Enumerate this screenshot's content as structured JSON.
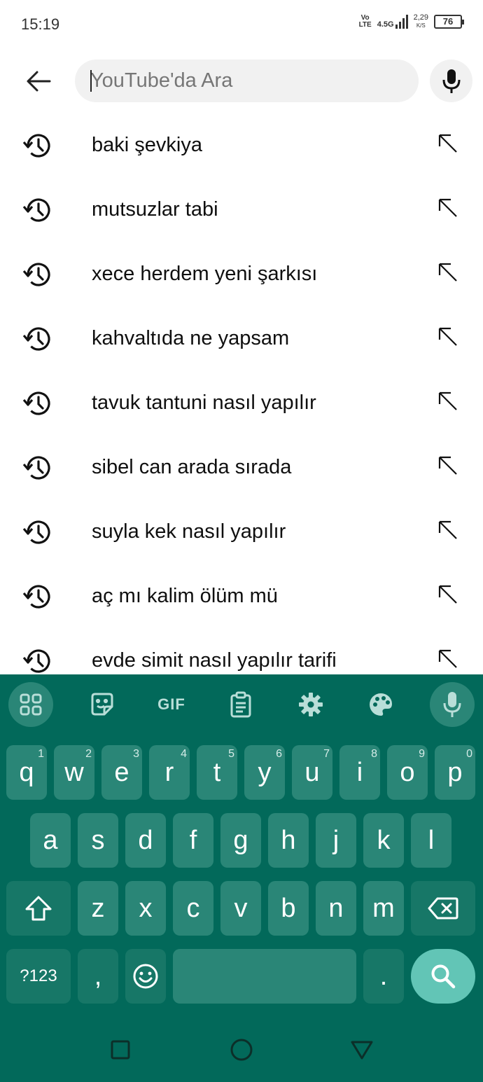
{
  "status_bar": {
    "time": "15:19",
    "volte_top": "Vo",
    "volte_bottom": "LTE",
    "network": "4.5G",
    "speed_value": "2,29",
    "speed_unit": "K/S",
    "battery": "76"
  },
  "search": {
    "placeholder": "YouTube'da Ara",
    "value": ""
  },
  "suggestions": [
    "baki şevkiya",
    "mutsuzlar tabi",
    "xece herdem yeni şarkısı",
    "kahvaltıda ne yapsam",
    "tavuk tantuni nasıl yapılır",
    "sibel can arada sırada",
    "suyla kek nasıl yapılır",
    "aç mı kalim ölüm mü",
    "evde simit nasıl yapılır tarifi"
  ],
  "keyboard": {
    "toolbar": {
      "gif_label": "GIF"
    },
    "row1": [
      {
        "key": "q",
        "hint": "1"
      },
      {
        "key": "w",
        "hint": "2"
      },
      {
        "key": "e",
        "hint": "3"
      },
      {
        "key": "r",
        "hint": "4"
      },
      {
        "key": "t",
        "hint": "5"
      },
      {
        "key": "y",
        "hint": "6"
      },
      {
        "key": "u",
        "hint": "7"
      },
      {
        "key": "i",
        "hint": "8"
      },
      {
        "key": "o",
        "hint": "9"
      },
      {
        "key": "p",
        "hint": "0"
      }
    ],
    "row2": [
      "a",
      "s",
      "d",
      "f",
      "g",
      "h",
      "j",
      "k",
      "l"
    ],
    "row3": [
      "z",
      "x",
      "c",
      "v",
      "b",
      "n",
      "m"
    ],
    "symbols_label": "?123",
    "comma": ",",
    "period": "."
  },
  "colors": {
    "keyboard_bg": "#02695a",
    "key_bg": "#2a8677",
    "search_key_bg": "#62c5b6"
  },
  "icons": {
    "back": "arrow-left-icon",
    "mic": "microphone-icon",
    "history": "history-icon",
    "fill_query": "arrow-up-left-icon",
    "shift": "shift-icon",
    "backspace": "backspace-icon",
    "emoji": "emoji-icon",
    "search": "search-icon"
  }
}
